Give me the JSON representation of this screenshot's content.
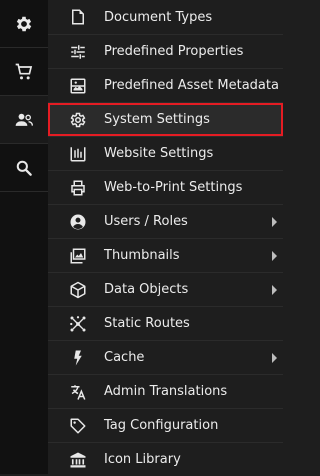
{
  "rail": {
    "items": [
      {
        "icon": "gear-icon"
      },
      {
        "icon": "cart-icon"
      },
      {
        "icon": "users-icon"
      },
      {
        "icon": "search-icon"
      }
    ]
  },
  "menu": {
    "items": [
      {
        "label": "Document Types",
        "icon": "document-types-icon",
        "submenu": false
      },
      {
        "label": "Predefined Properties",
        "icon": "sliders-icon",
        "submenu": false
      },
      {
        "label": "Predefined Asset Metadata",
        "icon": "asset-metadata-icon",
        "submenu": false
      },
      {
        "label": "System Settings",
        "icon": "gear-icon",
        "submenu": false,
        "selected": true
      },
      {
        "label": "Website Settings",
        "icon": "website-settings-icon",
        "submenu": false
      },
      {
        "label": "Web-to-Print Settings",
        "icon": "printer-icon",
        "submenu": false
      },
      {
        "label": "Users / Roles",
        "icon": "user-circle-icon",
        "submenu": true
      },
      {
        "label": "Thumbnails",
        "icon": "thumbnails-icon",
        "submenu": true
      },
      {
        "label": "Data Objects",
        "icon": "cube-icon",
        "submenu": true
      },
      {
        "label": "Static Routes",
        "icon": "routes-icon",
        "submenu": false
      },
      {
        "label": "Cache",
        "icon": "lightning-icon",
        "submenu": true
      },
      {
        "label": "Admin Translations",
        "icon": "translate-icon",
        "submenu": false
      },
      {
        "label": "Tag Configuration",
        "icon": "tag-icon",
        "submenu": false
      },
      {
        "label": "Icon Library",
        "icon": "library-icon",
        "submenu": false
      }
    ]
  },
  "colors": {
    "background": "#1e1e1e",
    "rail": "#111111",
    "text": "#ececec",
    "selection_border": "#e51c23"
  }
}
